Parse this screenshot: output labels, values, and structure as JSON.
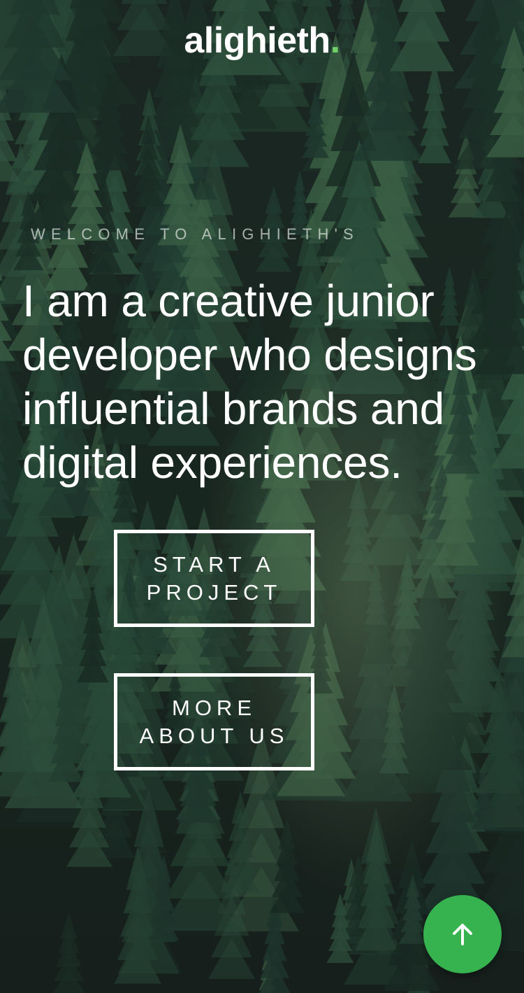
{
  "brand": {
    "name": "alighieth",
    "dot": ".",
    "accent_color": "#6fd36a"
  },
  "hero": {
    "eyebrow": "WELCOME TO ALIGHIETH'S",
    "headline": "I am a creative junior developer who designs influential brands and digital experiences."
  },
  "buttons": {
    "start_project": {
      "line1": "START A",
      "line2": "PROJECT"
    },
    "more_about": {
      "line1": "MORE",
      "line2": "ABOUT US"
    }
  },
  "scroll_top": {
    "icon": "arrow-up-icon",
    "color": "#36b24e"
  },
  "background": {
    "icon": "forest-image",
    "base_color": "#1b2420"
  }
}
